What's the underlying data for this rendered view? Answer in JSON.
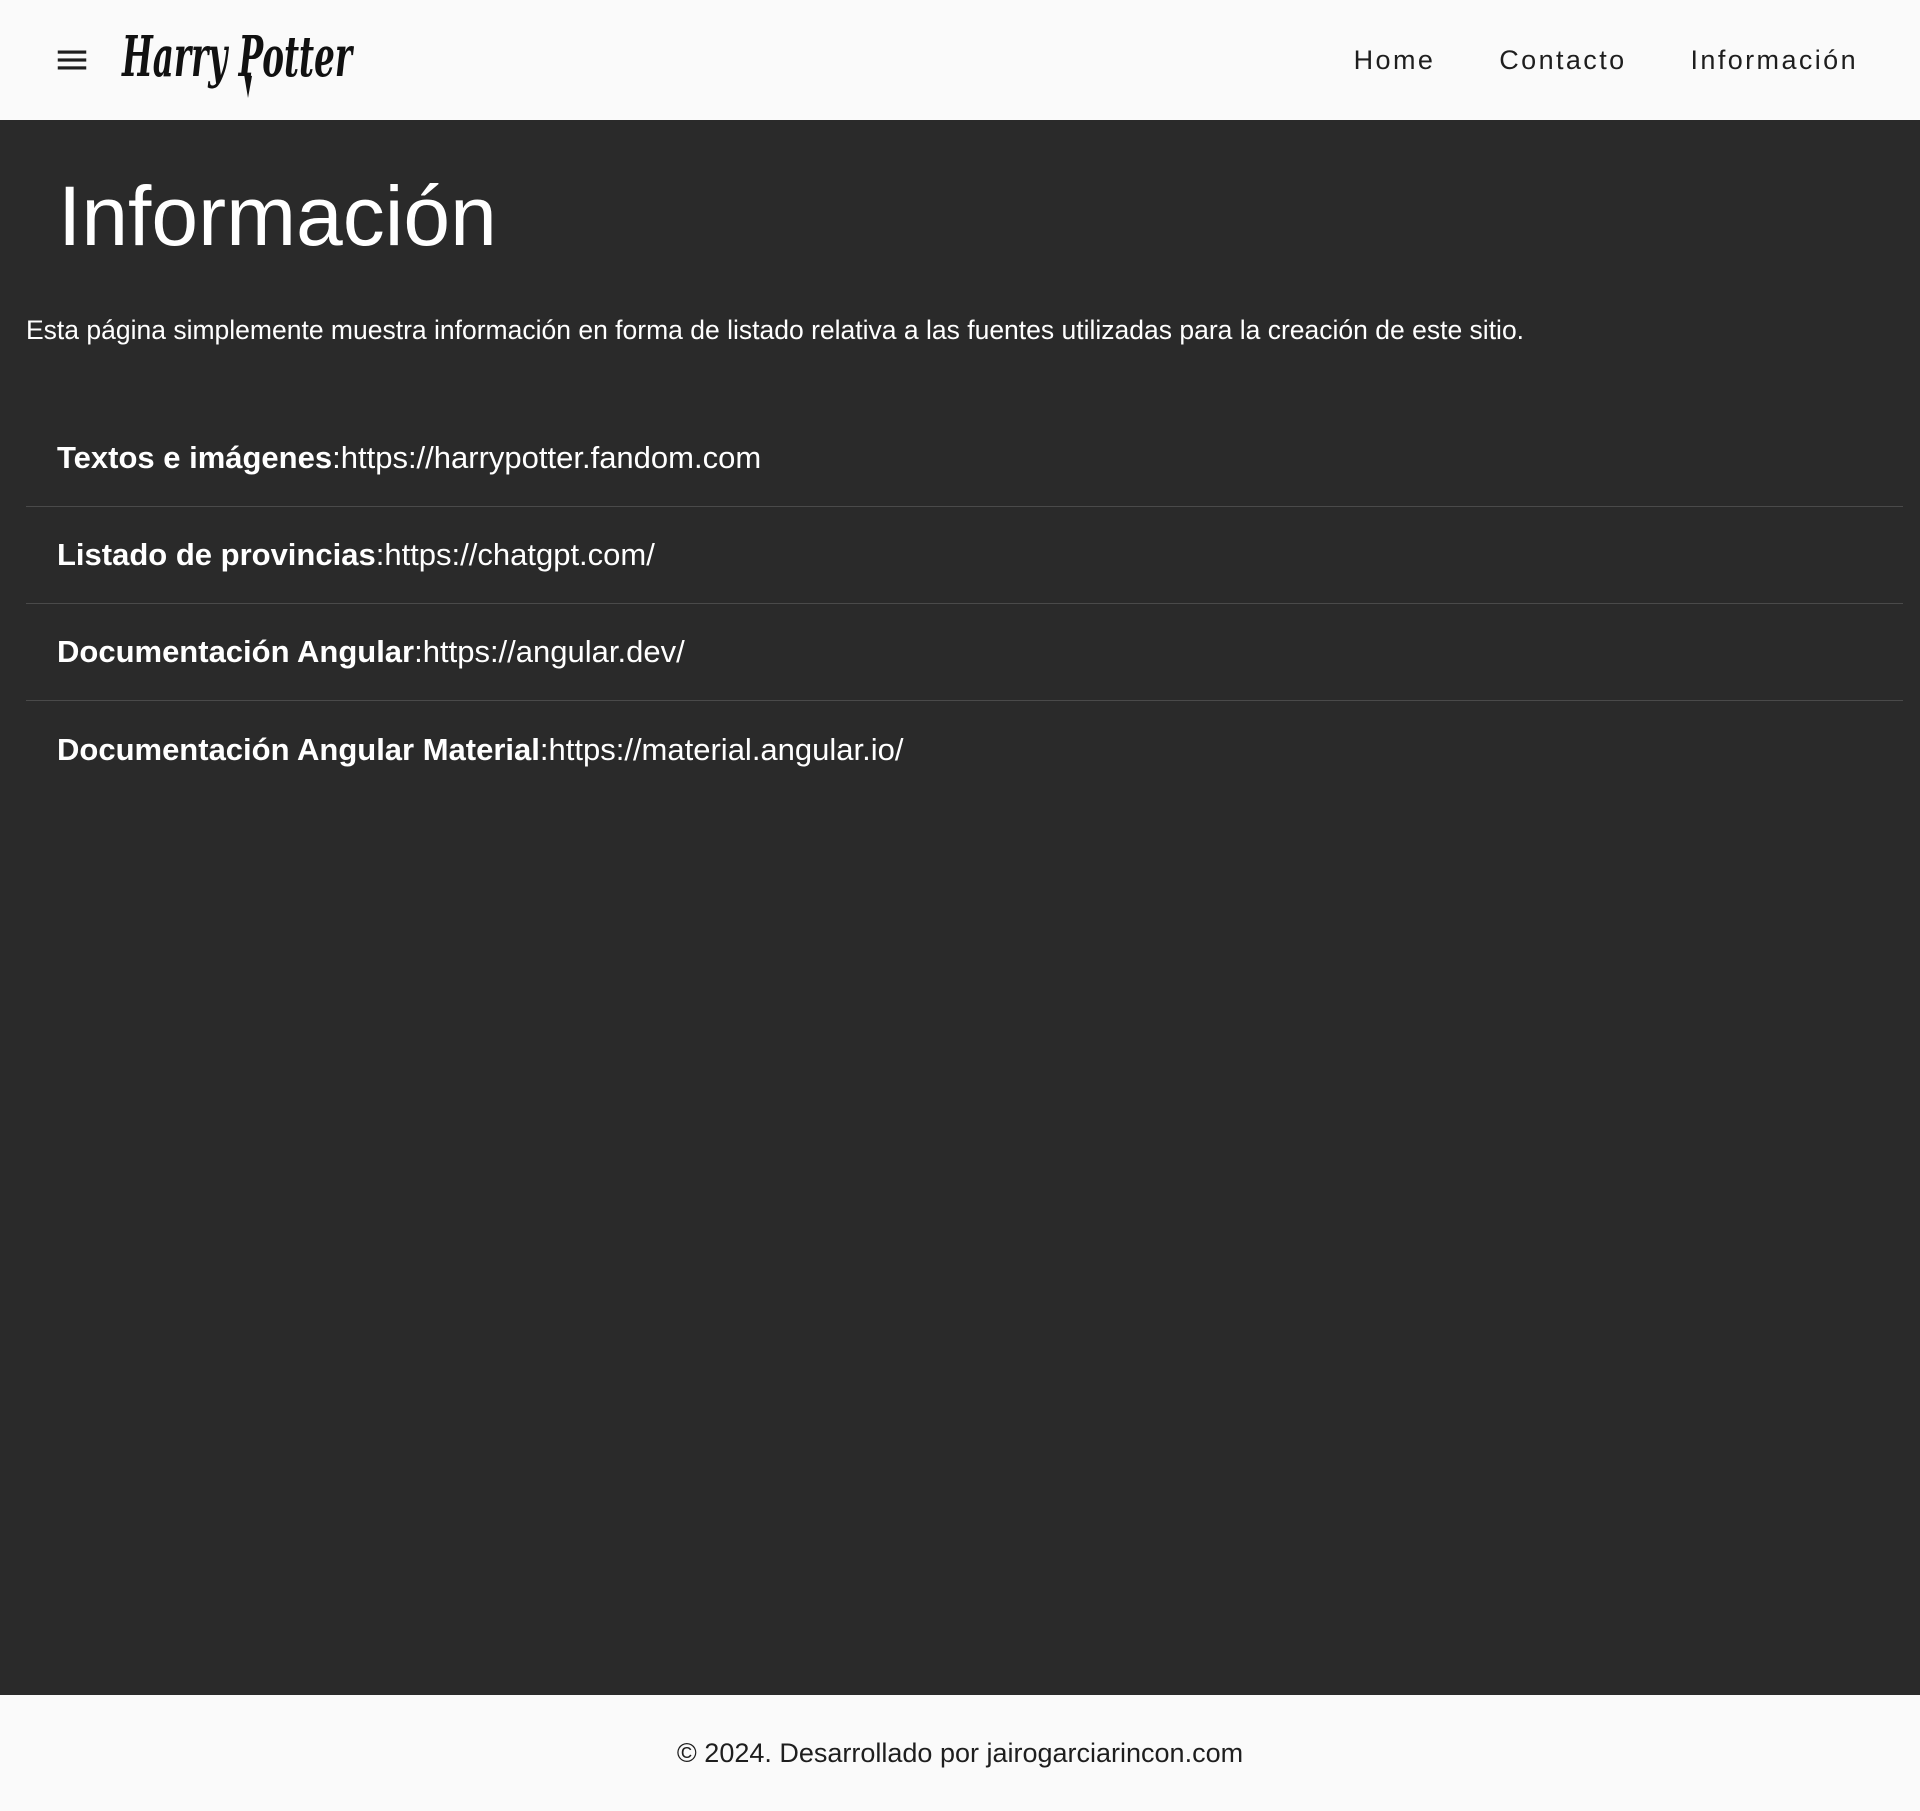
{
  "header": {
    "menu_icon": "menu-icon",
    "logo_text": "Harry Potter",
    "nav": [
      {
        "label": "Home"
      },
      {
        "label": "Contacto"
      },
      {
        "label": "Información"
      }
    ]
  },
  "main": {
    "title": "Información",
    "intro": "Esta página simplemente muestra información en forma de listado relativa a las fuentes utilizadas para la creación de este sitio.",
    "sources": [
      {
        "name": "Textos e imágenes",
        "separator": ": ",
        "url": "https://harrypotter.fandom.com"
      },
      {
        "name": "Listado de provincias",
        "separator": ": ",
        "url": "https://chatgpt.com/"
      },
      {
        "name": "Documentación Angular",
        "separator": ": ",
        "url": "https://angular.dev/"
      },
      {
        "name": "Documentación Angular Material",
        "separator": ": ",
        "url": "https://material.angular.io/"
      }
    ]
  },
  "footer": {
    "text": "© 2024. Desarrollado por jairogarciarincon.com"
  },
  "colors": {
    "toolbar_bg": "#fafafa",
    "content_bg": "#2a2a2a",
    "text_light": "#ffffff",
    "text_dark": "#1e1e1e",
    "divider": "#4a4a4a"
  }
}
